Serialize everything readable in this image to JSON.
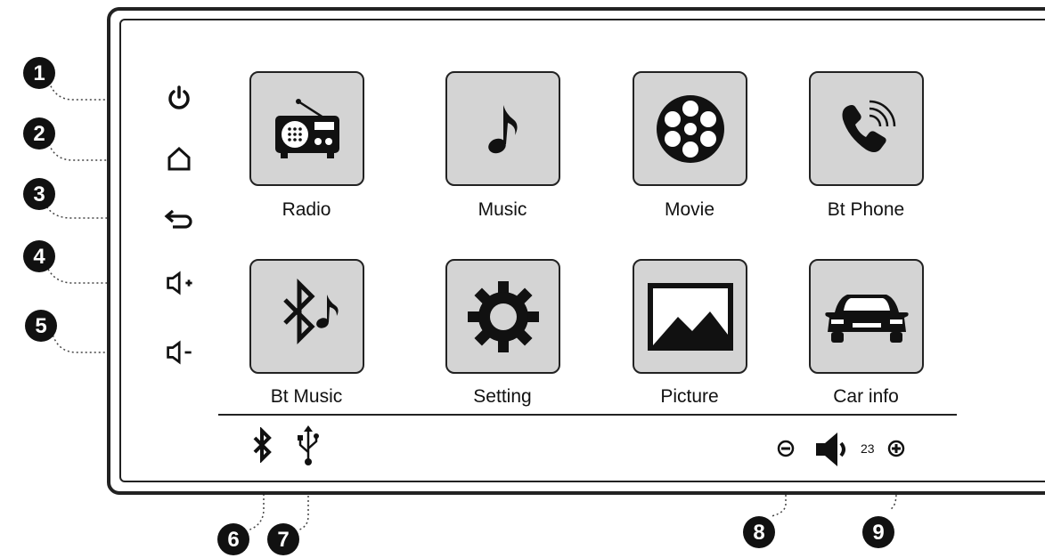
{
  "apps": [
    {
      "id": "radio",
      "label": "Radio",
      "icon": "radio-icon"
    },
    {
      "id": "music",
      "label": "Music",
      "icon": "music-note-icon"
    },
    {
      "id": "movie",
      "label": "Movie",
      "icon": "film-reel-icon"
    },
    {
      "id": "bt-phone",
      "label": "Bt Phone",
      "icon": "phone-icon"
    },
    {
      "id": "bt-music",
      "label": "Bt Music",
      "icon": "bluetooth-music-icon"
    },
    {
      "id": "setting",
      "label": "Setting",
      "icon": "gear-icon"
    },
    {
      "id": "picture",
      "label": "Picture",
      "icon": "picture-icon"
    },
    {
      "id": "car-info",
      "label": "Car info",
      "icon": "car-icon"
    }
  ],
  "side_buttons": [
    {
      "number": "1",
      "icon": "power-icon"
    },
    {
      "number": "2",
      "icon": "home-icon"
    },
    {
      "number": "3",
      "icon": "back-icon"
    },
    {
      "number": "4",
      "icon": "volume-up-icon"
    },
    {
      "number": "5",
      "icon": "volume-down-icon"
    }
  ],
  "status_bar": {
    "bluetooth_callout": "6",
    "usb_callout": "7",
    "volume_down_callout": "8",
    "volume_up_callout": "9",
    "volume_level": "23"
  },
  "colors": {
    "tile_fill": "#d4d4d4",
    "ink": "#111111"
  }
}
